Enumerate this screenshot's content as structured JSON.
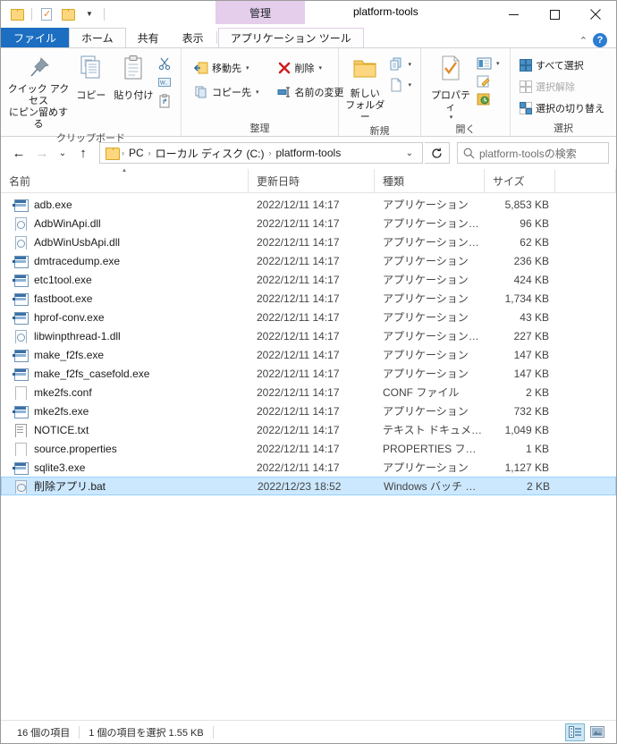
{
  "window": {
    "title": "platform-tools",
    "contextual_tab_group": "管理",
    "minimize": "—",
    "maximize": "☐",
    "close": "✕"
  },
  "quick_access_toolbar": {
    "items": [
      {
        "name": "folder-icon",
        "label": "プロパティ"
      },
      {
        "name": "new-folder-icon",
        "label": "新しいフォルダー"
      },
      {
        "name": "customize-caret-icon",
        "label": "クイック アクセス ツール バーのカスタマイズ"
      }
    ]
  },
  "ribbon_tabs": {
    "file": "ファイル",
    "tabs": [
      "ホーム",
      "共有",
      "表示"
    ],
    "contextual": "アプリケーション ツール",
    "active": "ホーム",
    "collapse_icon": "⌃",
    "help_icon": "?"
  },
  "ribbon": {
    "groups": [
      {
        "title": "クリップボード",
        "big_buttons": [
          {
            "name": "pin-to-quick-access",
            "label": "クイック アクセス\nにピン留めする",
            "line1": "クイック アクセス",
            "line2": "にピン留めする"
          },
          {
            "name": "copy-button",
            "label": "コピー"
          },
          {
            "name": "paste-button",
            "label": "貼り付け"
          }
        ],
        "small_buttons": [
          {
            "name": "cut-button",
            "label": ""
          },
          {
            "name": "copy-path-button",
            "label": ""
          },
          {
            "name": "paste-shortcut-button",
            "label": ""
          }
        ]
      },
      {
        "title": "整理",
        "small_buttons": [
          {
            "name": "move-to-button",
            "label": "移動先",
            "dropdown": "▾"
          },
          {
            "name": "copy-to-button",
            "label": "コピー先",
            "dropdown": "▾"
          },
          {
            "name": "delete-button",
            "label": "削除",
            "dropdown": "▾"
          },
          {
            "name": "rename-button",
            "label": "名前の変更",
            "dropdown": ""
          }
        ]
      },
      {
        "title": "新規",
        "big_buttons": [
          {
            "name": "new-folder-button",
            "line1": "新しい",
            "line2": "フォルダー"
          }
        ],
        "small_buttons": [
          {
            "name": "new-item-button",
            "label": "",
            "dropdown": "▾"
          },
          {
            "name": "easy-access-button",
            "label": "",
            "dropdown": "▾"
          }
        ]
      },
      {
        "title": "開く",
        "big_buttons": [
          {
            "name": "properties-button",
            "label": "プロパティ",
            "dropdown": "▾"
          }
        ],
        "small_buttons": [
          {
            "name": "open-with-button",
            "label": "",
            "dropdown": "▾"
          },
          {
            "name": "edit-button",
            "label": ""
          },
          {
            "name": "history-button",
            "label": ""
          }
        ]
      },
      {
        "title": "選択",
        "small_buttons": [
          {
            "name": "select-all-button",
            "label": "すべて選択"
          },
          {
            "name": "select-none-button",
            "label": "選択解除"
          },
          {
            "name": "invert-selection-button",
            "label": "選択の切り替え"
          }
        ]
      }
    ]
  },
  "navigation": {
    "back_icon": "←",
    "forward_icon": "→",
    "recent_icon": "⌄",
    "up_icon": "↑",
    "breadcrumbs": [
      "PC",
      "ローカル ディスク (C:)",
      "platform-tools"
    ],
    "separator": "›",
    "dropdown_icon": "⌄",
    "refresh_icon": "↻"
  },
  "search": {
    "placeholder": "platform-toolsの検索",
    "icon": "search-icon"
  },
  "columns": [
    {
      "key": "name",
      "label": "名前",
      "sorted": true
    },
    {
      "key": "date",
      "label": "更新日時",
      "sorted": false
    },
    {
      "key": "type",
      "label": "種類",
      "sorted": false
    },
    {
      "key": "size",
      "label": "サイズ",
      "sorted": false
    }
  ],
  "files": [
    {
      "name": "adb.exe",
      "date": "2022/12/11 14:17",
      "type": "アプリケーション",
      "size": "5,853 KB",
      "icon": "exe",
      "selected": false
    },
    {
      "name": "AdbWinApi.dll",
      "date": "2022/12/11 14:17",
      "type": "アプリケーション拡張",
      "size": "96 KB",
      "icon": "dll",
      "selected": false
    },
    {
      "name": "AdbWinUsbApi.dll",
      "date": "2022/12/11 14:17",
      "type": "アプリケーション拡張",
      "size": "62 KB",
      "icon": "dll",
      "selected": false
    },
    {
      "name": "dmtracedump.exe",
      "date": "2022/12/11 14:17",
      "type": "アプリケーション",
      "size": "236 KB",
      "icon": "exe",
      "selected": false
    },
    {
      "name": "etc1tool.exe",
      "date": "2022/12/11 14:17",
      "type": "アプリケーション",
      "size": "424 KB",
      "icon": "exe",
      "selected": false
    },
    {
      "name": "fastboot.exe",
      "date": "2022/12/11 14:17",
      "type": "アプリケーション",
      "size": "1,734 KB",
      "icon": "exe",
      "selected": false
    },
    {
      "name": "hprof-conv.exe",
      "date": "2022/12/11 14:17",
      "type": "アプリケーション",
      "size": "43 KB",
      "icon": "exe",
      "selected": false
    },
    {
      "name": "libwinpthread-1.dll",
      "date": "2022/12/11 14:17",
      "type": "アプリケーション拡張",
      "size": "227 KB",
      "icon": "dll",
      "selected": false
    },
    {
      "name": "make_f2fs.exe",
      "date": "2022/12/11 14:17",
      "type": "アプリケーション",
      "size": "147 KB",
      "icon": "exe",
      "selected": false
    },
    {
      "name": "make_f2fs_casefold.exe",
      "date": "2022/12/11 14:17",
      "type": "アプリケーション",
      "size": "147 KB",
      "icon": "exe",
      "selected": false
    },
    {
      "name": "mke2fs.conf",
      "date": "2022/12/11 14:17",
      "type": "CONF ファイル",
      "size": "2 KB",
      "icon": "doc",
      "selected": false
    },
    {
      "name": "mke2fs.exe",
      "date": "2022/12/11 14:17",
      "type": "アプリケーション",
      "size": "732 KB",
      "icon": "exe",
      "selected": false
    },
    {
      "name": "NOTICE.txt",
      "date": "2022/12/11 14:17",
      "type": "テキスト ドキュメント",
      "size": "1,049 KB",
      "icon": "txt",
      "selected": false
    },
    {
      "name": "source.properties",
      "date": "2022/12/11 14:17",
      "type": "PROPERTIES ファイル",
      "size": "1 KB",
      "icon": "doc",
      "selected": false
    },
    {
      "name": "sqlite3.exe",
      "date": "2022/12/11 14:17",
      "type": "アプリケーション",
      "size": "1,127 KB",
      "icon": "exe",
      "selected": false
    },
    {
      "name": "削除アプリ.bat",
      "date": "2022/12/23 18:52",
      "type": "Windows バッチ ファ...",
      "size": "2 KB",
      "icon": "bat",
      "selected": true
    }
  ],
  "status_bar": {
    "item_count": "16 個の項目",
    "selection": "1 個の項目を選択  1.55 KB",
    "view_details_icon": "details-view-icon",
    "view_large_icon": "large-icons-view-icon"
  },
  "colors": {
    "file_tab": "#1b6ec2",
    "contextual_tab": "#e5cdec",
    "selection": "#cce8ff",
    "selection_border": "#99d1ff",
    "help_blue": "#2b7cd3",
    "delete_red": "#cc2222"
  }
}
